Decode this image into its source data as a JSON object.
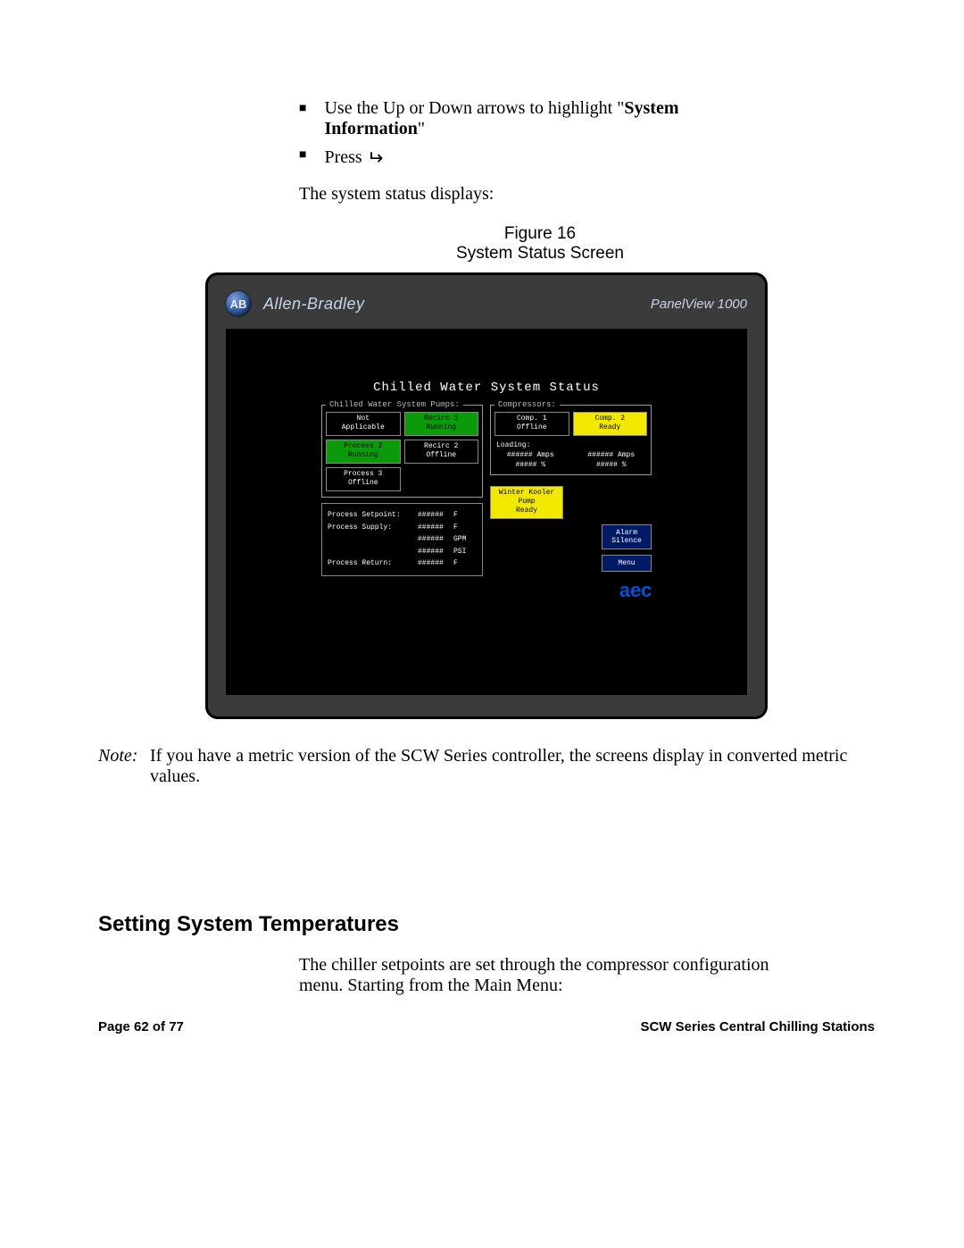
{
  "intro": {
    "bullet1_pre": "Use the Up or Down arrows to highlight \"",
    "bullet1_bold": "System Information",
    "bullet1_post": "\"",
    "bullet2": "Press ",
    "after": "The system status displays:"
  },
  "figure": {
    "line1": "Figure 16",
    "line2": "System Status Screen"
  },
  "hmi": {
    "logo_text": "AB",
    "brand": "Allen-Bradley",
    "model": "PanelView 1000",
    "title": "Chilled Water System Status",
    "pumps_legend": "Chilled Water System Pumps:",
    "comp_legend": "Compressors:",
    "pumps": [
      {
        "l1": "Not",
        "l2": "Applicable",
        "cls": ""
      },
      {
        "l1": "Recirc 1",
        "l2": "Running",
        "cls": "green"
      },
      {
        "l1": "Process 2",
        "l2": "Running",
        "cls": "green"
      },
      {
        "l1": "Recirc 2",
        "l2": "Offline",
        "cls": ""
      },
      {
        "l1": "Process 3",
        "l2": "Offline",
        "cls": ""
      }
    ],
    "comps": [
      {
        "l1": "Comp. 1",
        "l2": "Offline",
        "cls": ""
      },
      {
        "l1": "Comp. 2",
        "l2": "Ready",
        "cls": "yellow"
      }
    ],
    "loading_label": "Loading:",
    "load": [
      {
        "v": "######",
        "u": "Amps"
      },
      {
        "v": "######",
        "u": "Amps"
      },
      {
        "v": "#####",
        "u": "%"
      },
      {
        "v": "#####",
        "u": "%"
      }
    ],
    "winter": {
      "l1": "Winter Kooler",
      "l2": "Pump",
      "l3": "Ready"
    },
    "readouts": [
      {
        "lbl": "Process Setpoint:",
        "v": "######",
        "u": "F"
      },
      {
        "lbl": "Process Supply:",
        "v": "######",
        "u": "F"
      },
      {
        "lbl": "",
        "v": "######",
        "u": "GPM"
      },
      {
        "lbl": "",
        "v": "######",
        "u": "PSI"
      },
      {
        "lbl": "Process Return:",
        "v": "######",
        "u": "F"
      }
    ],
    "alarm_btn": "Alarm\nSilence",
    "menu_btn": "Menu",
    "aec": "aec"
  },
  "note": {
    "label": "Note:",
    "text": "If you have a metric version of the SCW Series controller, the screens display in converted metric values."
  },
  "section_heading": "Setting System Temperatures",
  "section_text": "The chiller setpoints are set through the compressor configuration menu.  Starting from the Main Menu:",
  "footer": {
    "left": "Page 62 of 77",
    "right": "SCW Series Central Chilling Stations"
  }
}
